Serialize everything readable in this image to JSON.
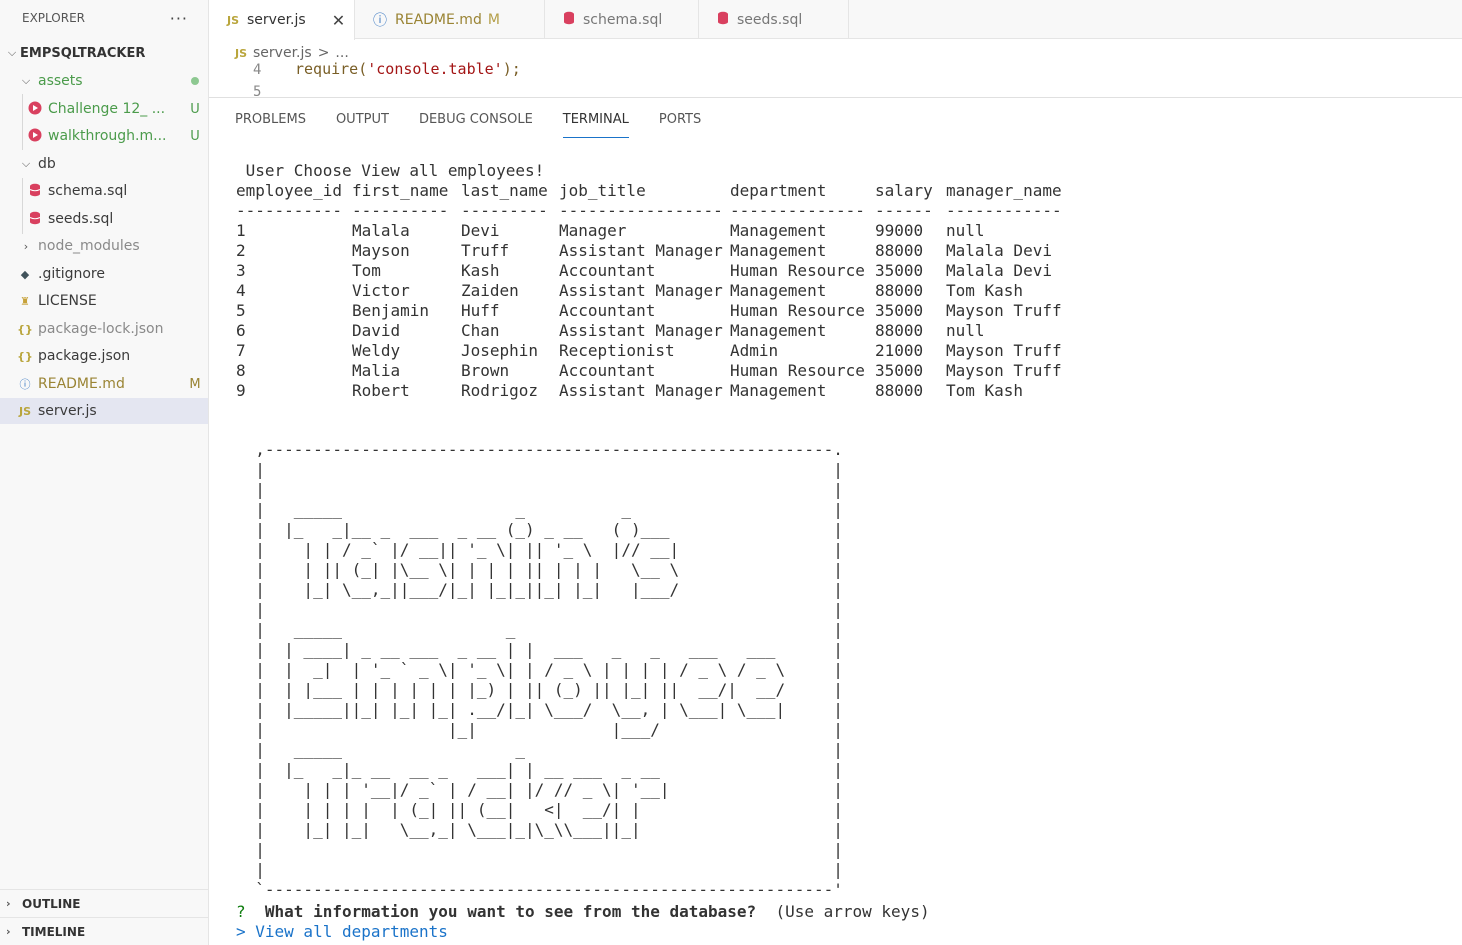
{
  "explorer": {
    "title": "EXPLORER",
    "more": "···",
    "root": "EMPSQLTRACKER",
    "items": [
      {
        "label": "assets",
        "badge": "",
        "kind": "folder-open"
      },
      {
        "label": "Challenge 12_ ...",
        "badge": "U",
        "kind": "video"
      },
      {
        "label": "walkthrough.m...",
        "badge": "U",
        "kind": "video"
      },
      {
        "label": "db",
        "badge": "",
        "kind": "folder-open"
      },
      {
        "label": "schema.sql",
        "badge": "",
        "kind": "db"
      },
      {
        "label": "seeds.sql",
        "badge": "",
        "kind": "db"
      },
      {
        "label": "node_modules",
        "badge": "",
        "kind": "folder-closed"
      },
      {
        "label": ".gitignore",
        "badge": "",
        "kind": "git"
      },
      {
        "label": "LICENSE",
        "badge": "",
        "kind": "license"
      },
      {
        "label": "package-lock.json",
        "badge": "",
        "kind": "json"
      },
      {
        "label": "package.json",
        "badge": "",
        "kind": "json"
      },
      {
        "label": "README.md",
        "badge": "M",
        "kind": "info"
      },
      {
        "label": "server.js",
        "badge": "",
        "kind": "js"
      }
    ],
    "outline": "OUTLINE",
    "timeline": "TIMELINE"
  },
  "tabs": [
    {
      "label": "server.js",
      "icon": "JS",
      "modified": "",
      "active": true
    },
    {
      "label": "README.md",
      "icon": "ⓘ",
      "modified": "M",
      "active": false
    },
    {
      "label": "schema.sql",
      "icon": "db",
      "modified": "",
      "active": false
    },
    {
      "label": "seeds.sql",
      "icon": "db",
      "modified": "",
      "active": false
    }
  ],
  "breadcrumb": {
    "file": "server.js",
    "sep": ">",
    "rest": "..."
  },
  "editor": {
    "line4_num": "4",
    "line4_fn": "require(",
    "line4_str": "'console.table'",
    "line4_end": ");",
    "line5_num": "5"
  },
  "panel_tabs": [
    "PROBLEMS",
    "OUTPUT",
    "DEBUG CONSOLE",
    "TERMINAL",
    "PORTS"
  ],
  "terminal": {
    "choice_line": " User Choose View all employees!",
    "headers": [
      "employee_id",
      "first_name",
      "last_name",
      "job_title",
      "department",
      "salary",
      "manager_name"
    ],
    "dashes": [
      "-----------",
      "----------",
      "---------",
      "-----------------",
      "--------------",
      "------",
      "------------"
    ],
    "rows": [
      [
        "1",
        "Malala",
        "Devi",
        "Manager",
        "Management",
        "99000",
        "null"
      ],
      [
        "2",
        "Mayson",
        "Truff",
        "Assistant Manager",
        "Management",
        "88000",
        "Malala Devi"
      ],
      [
        "3",
        "Tom",
        "Kash",
        "Accountant",
        "Human Resource",
        "35000",
        "Malala Devi"
      ],
      [
        "4",
        "Victor",
        "Zaiden",
        "Assistant Manager",
        "Management",
        "88000",
        "Tom Kash"
      ],
      [
        "5",
        "Benjamin",
        "Huff",
        "Accountant",
        "Human Resource",
        "35000",
        "Mayson Truff"
      ],
      [
        "6",
        "David",
        "Chan",
        "Assistant Manager",
        "Management",
        "88000",
        "null"
      ],
      [
        "7",
        "Weldy",
        "Josephin",
        "Receptionist",
        "Admin",
        "21000",
        "Mayson Truff"
      ],
      [
        "8",
        "Malia",
        "Brown",
        "Accountant",
        "Human Resource",
        "35000",
        "Mayson Truff"
      ],
      [
        "9",
        "Robert",
        "Rodrigoz",
        "Assistant Manager",
        "Management",
        "88000",
        "Tom Kash"
      ]
    ],
    "banner": "  ,-----------------------------------------------------------.\n  |                                                           |\n  |                                                           |\n  |   _____                  _          _                     |\n  |  |_   _|__ _  ___  _ __ (_) _ __   ( )___                 |\n  |    | | / _` |/ __|| '_ \\| || '_ \\  |// __|                |\n  |    | || (_| |\\__ \\| | | | || | | |   \\__ \\                |\n  |    |_| \\__,_||___/|_| |_|_||_| |_|   |___/                |\n  |                                                           |\n  |   _____                 _                                 |\n  |  | ____| _ __ ___  _ __ | |  ___   _   _   ___   ___      |\n  |  |  _|  | '_ ` _ \\| '_ \\| | / _ \\ | | | | / _ \\ / _ \\     |\n  |  | |___ | | | | | | |_) | || (_) || |_| ||  __/|  __/     |\n  |  |_____||_| |_| |_| .__/|_| \\___/  \\__, | \\___| \\___|     |\n  |                   |_|              |___/                  |\n  |   _____                  _                                |\n  |  |_   _|_ __  __ _   ___| | __ ___  _ __                  |\n  |    | | | '__|/ _` | / __| |/ // _ \\| '__|                 |\n  |    | | | |  | (_| || (__|   <|  __/| |                    |\n  |    |_| |_|   \\__,_| \\___|_|\\_\\\\___||_|                    |\n  |                                                           |\n  |                                                           |\n  `-----------------------------------------------------------'",
    "prompt_mark": "?",
    "prompt_text": "What information you want to see from the database?",
    "prompt_hint": "(Use arrow keys)",
    "answer": "> View all departments"
  },
  "colors": {
    "accent": "#1a73c9",
    "modified": "#b5a04b",
    "untracked": "#4b9b4b",
    "selected": "#e4e6f1"
  }
}
